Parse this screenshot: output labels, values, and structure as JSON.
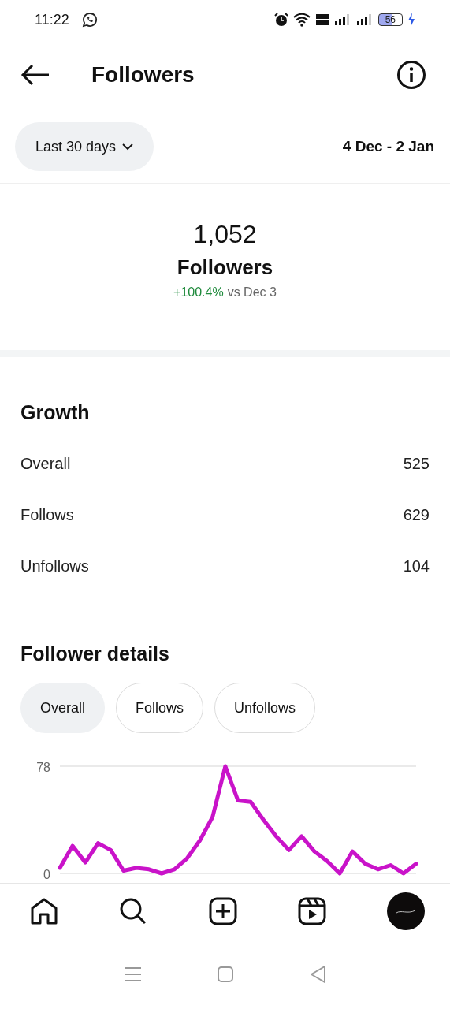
{
  "status_bar": {
    "time": "11:22",
    "battery": "56"
  },
  "header": {
    "title": "Followers"
  },
  "range": {
    "label": "Last 30 days",
    "dates": "4 Dec - 2 Jan"
  },
  "summary": {
    "count": "1,052",
    "label": "Followers",
    "change": "+100.4%",
    "comparison": "vs Dec 3"
  },
  "growth": {
    "title": "Growth",
    "rows": [
      {
        "label": "Overall",
        "value": "525"
      },
      {
        "label": "Follows",
        "value": "629"
      },
      {
        "label": "Unfollows",
        "value": "104"
      }
    ]
  },
  "details": {
    "title": "Follower details",
    "tabs": [
      {
        "label": "Overall",
        "selected": true
      },
      {
        "label": "Follows",
        "selected": false
      },
      {
        "label": "Unfollows",
        "selected": false
      }
    ],
    "chart_data": {
      "type": "line",
      "ylim": [
        0,
        78
      ],
      "yticks": [
        0,
        78
      ],
      "series": [
        {
          "color": "#c913c9",
          "values": [
            4,
            20,
            8,
            22,
            17,
            2,
            4,
            3,
            0,
            3,
            11,
            24,
            41,
            78,
            53,
            52,
            39,
            27,
            17,
            27,
            16,
            9,
            0,
            16,
            7,
            3,
            6,
            0,
            7
          ]
        }
      ]
    }
  },
  "nav": [
    {
      "kind": "home"
    },
    {
      "kind": "search"
    },
    {
      "kind": "create"
    },
    {
      "kind": "reels"
    },
    {
      "kind": "profile"
    }
  ]
}
